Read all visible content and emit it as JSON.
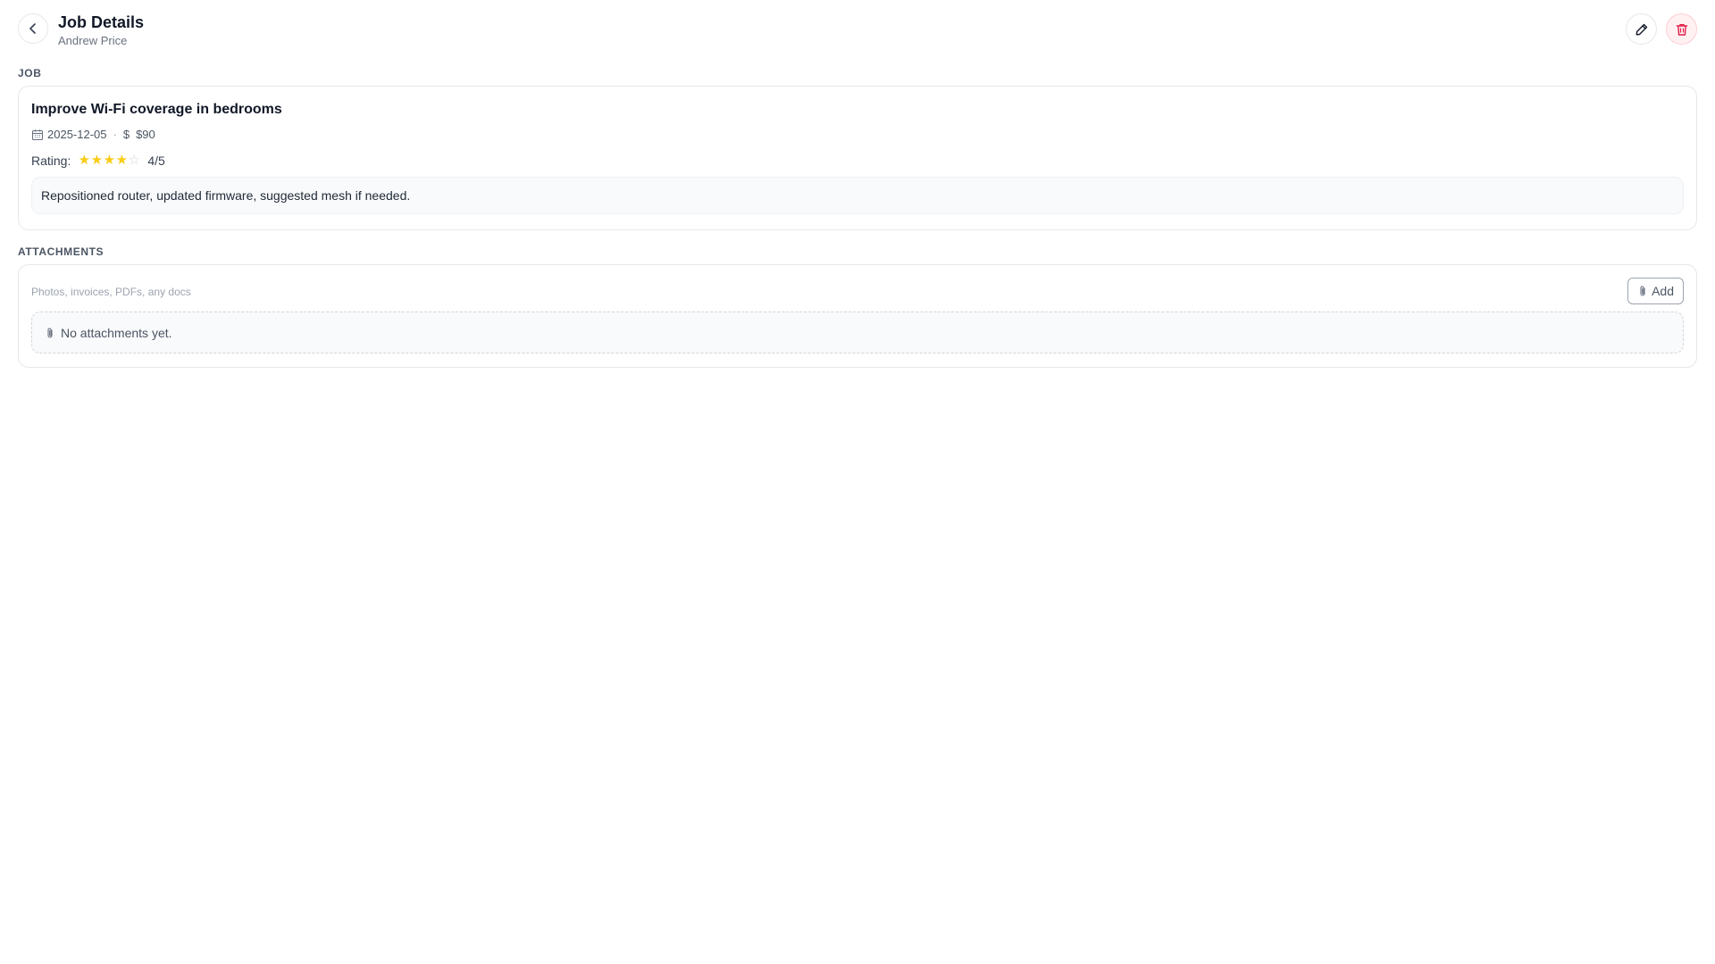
{
  "header": {
    "title": "Job Details",
    "subtitle": "Andrew Price",
    "back_icon": "chevron-left-icon",
    "edit_icon": "pencil-icon",
    "delete_icon": "trash-icon"
  },
  "job_section": {
    "label": "JOB",
    "title": "Improve Wi-Fi coverage in bedrooms",
    "date": "2025-12-05",
    "separator": "·",
    "currency_symbol": "$",
    "price": "$90",
    "rating_label": "Rating:",
    "rating_value": 4,
    "rating_max": 5,
    "rating_text": "4/5",
    "notes": "Repositioned router, updated firmware, suggested mesh if needed."
  },
  "attachments_section": {
    "label": "ATTACHMENTS",
    "hint": "Photos, invoices, PDFs, any docs",
    "add_label": "Add",
    "empty_text": "No attachments yet."
  },
  "colors": {
    "star_filled": "#facc15",
    "star_empty": "#d1d5db",
    "delete_accent": "#e11d48"
  }
}
